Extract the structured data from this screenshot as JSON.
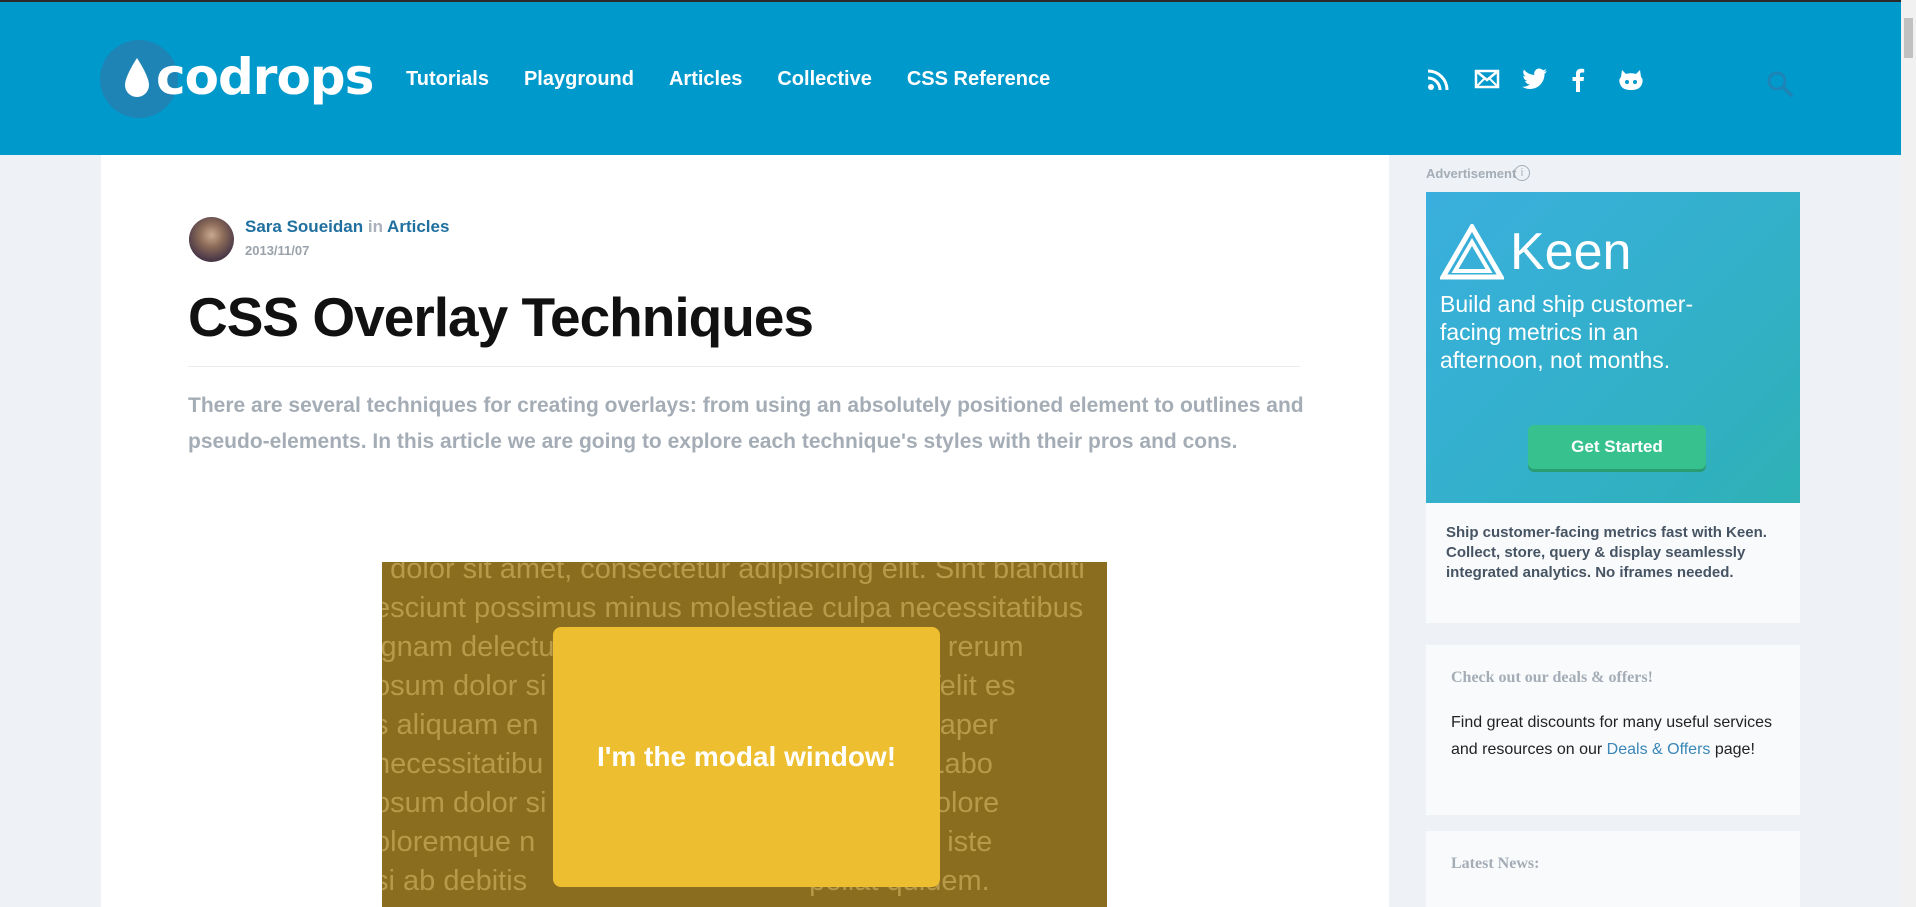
{
  "header": {
    "logo_text": "codrops",
    "nav": [
      "Tutorials",
      "Playground",
      "Articles",
      "Collective",
      "CSS Reference"
    ],
    "social_icons": [
      "rss-icon",
      "mail-icon",
      "twitter-icon",
      "facebook-icon",
      "github-icon"
    ],
    "search_icon": "search-icon"
  },
  "article": {
    "author": "Sara Soueidan",
    "in_label": "in",
    "category": "Articles",
    "date": "2013/11/07",
    "title": "CSS Overlay Techniques",
    "lead": "There are several techniques for creating overlays: from using an absolutely positioned element to outlines and pseudo-elements. In this article we are going to explore each technique's styles with their pros and cons.",
    "demo": {
      "background_lines": [
        "t dolor sit amet, consectetur adipisicing elit. Sint blanditi",
        "esciunt possimus minus molestiae culpa necessitatibus",
        "ignam delectus                                   periam rerum",
        "osum dolor si                                     g elit. Velit es",
        "s aliquam en                                    ousdam aper",
        "necessitatibu                                   mmodi! Labo",
        "osum dolor si                                    g elit. Dolore",
        "oloremque n                                    ro officiis iste",
        "si ab debitis                                   pellat quidem."
      ],
      "modal_text": "I'm the modal window!"
    }
  },
  "sidebar": {
    "ad_label": "Advertisement",
    "ad_info": "i",
    "ad_brand": "Keen",
    "ad_copy": "Build and ship customer-facing metrics in an afternoon, not months.",
    "ad_cta": "Get Started",
    "ad_description": "Ship customer-facing metrics fast with Keen. Collect, store, query & display seamlessly integrated analytics. No iframes needed.",
    "deals": {
      "heading": "Check out our deals & offers!",
      "text_before": "Find great discounts for many useful services and resources on our ",
      "link": "Deals & Offers",
      "text_after": " page!"
    },
    "news": {
      "heading": "Latest News:"
    }
  },
  "colors": {
    "header_bg": "#0099cc",
    "page_bg": "#eef1f5",
    "link": "#1f6f9f",
    "modal": "#edbe2f",
    "demo_bg": "#8a6d1f",
    "cta": "#36c18f"
  }
}
